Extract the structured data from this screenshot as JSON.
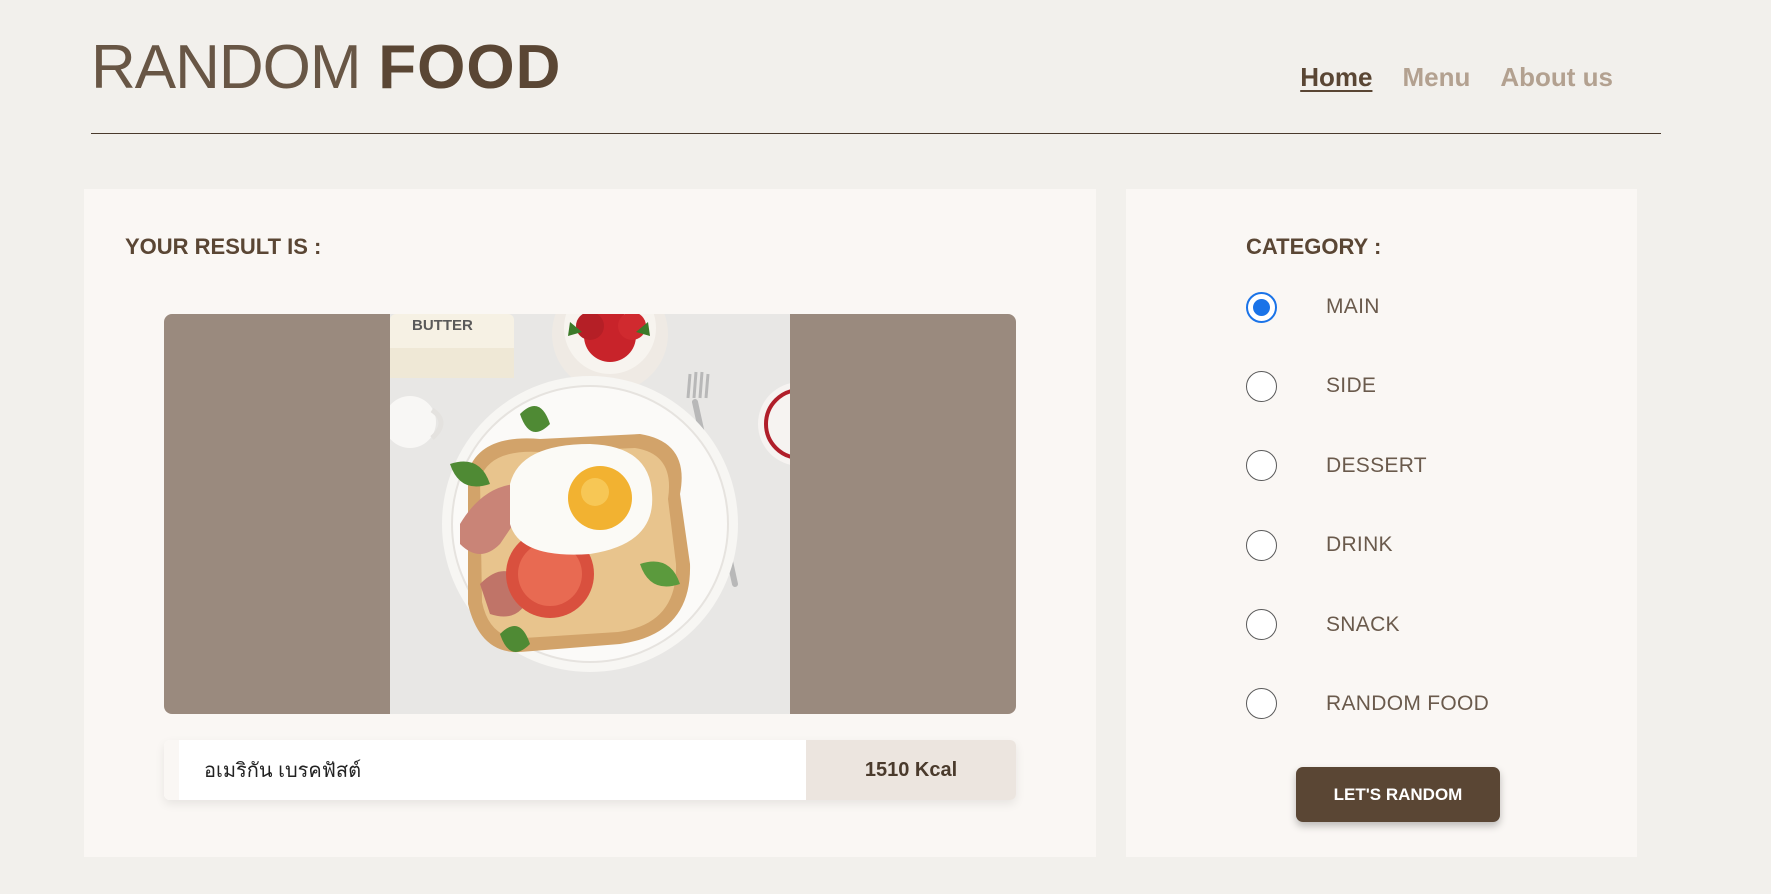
{
  "logo": {
    "light": "RANDOM",
    "bold": "FOOD"
  },
  "nav": [
    {
      "label": "Home",
      "active": true
    },
    {
      "label": "Menu",
      "active": false
    },
    {
      "label": "About us",
      "active": false
    }
  ],
  "result": {
    "title": "YOUR RESULT IS :",
    "food_name": "อเมริกัน เบรคฟัสต์",
    "kcal": "1510 Kcal",
    "image_label": "BUTTER"
  },
  "category": {
    "title": "CATEGORY :",
    "options": [
      {
        "label": "MAIN",
        "checked": true
      },
      {
        "label": "SIDE",
        "checked": false
      },
      {
        "label": "DESSERT",
        "checked": false
      },
      {
        "label": "DRINK",
        "checked": false
      },
      {
        "label": "SNACK",
        "checked": false
      },
      {
        "label": "RANDOM FOOD",
        "checked": false
      }
    ]
  },
  "random_button": "LET'S RANDOM",
  "colors": {
    "background": "#f2f0ec",
    "panel": "#faf7f4",
    "brown": "#5a4634",
    "image_frame": "#9a8a7e",
    "radio_checked": "#1a73e8"
  }
}
